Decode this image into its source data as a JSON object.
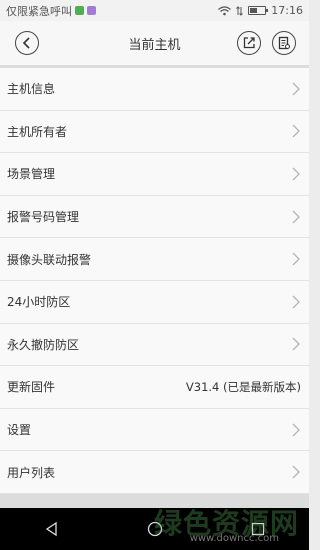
{
  "status_bar": {
    "carrier_text": "仅限紧急呼叫",
    "time": "17:16"
  },
  "header": {
    "title": "当前主机"
  },
  "menu": {
    "items": [
      {
        "label": "主机信息",
        "value": ""
      },
      {
        "label": "主机所有者",
        "value": ""
      },
      {
        "label": "场景管理",
        "value": ""
      },
      {
        "label": "报警号码管理",
        "value": ""
      },
      {
        "label": "摄像头联动报警",
        "value": ""
      },
      {
        "label": "24小时防区",
        "value": ""
      },
      {
        "label": "永久撤防防区",
        "value": ""
      },
      {
        "label": "更新固件",
        "value": "V31.4 (已是最新版本)"
      },
      {
        "label": "设置",
        "value": ""
      },
      {
        "label": "用户列表",
        "value": ""
      }
    ]
  },
  "watermark": {
    "text": "绿色资源网",
    "url": "www.downcc.com"
  }
}
